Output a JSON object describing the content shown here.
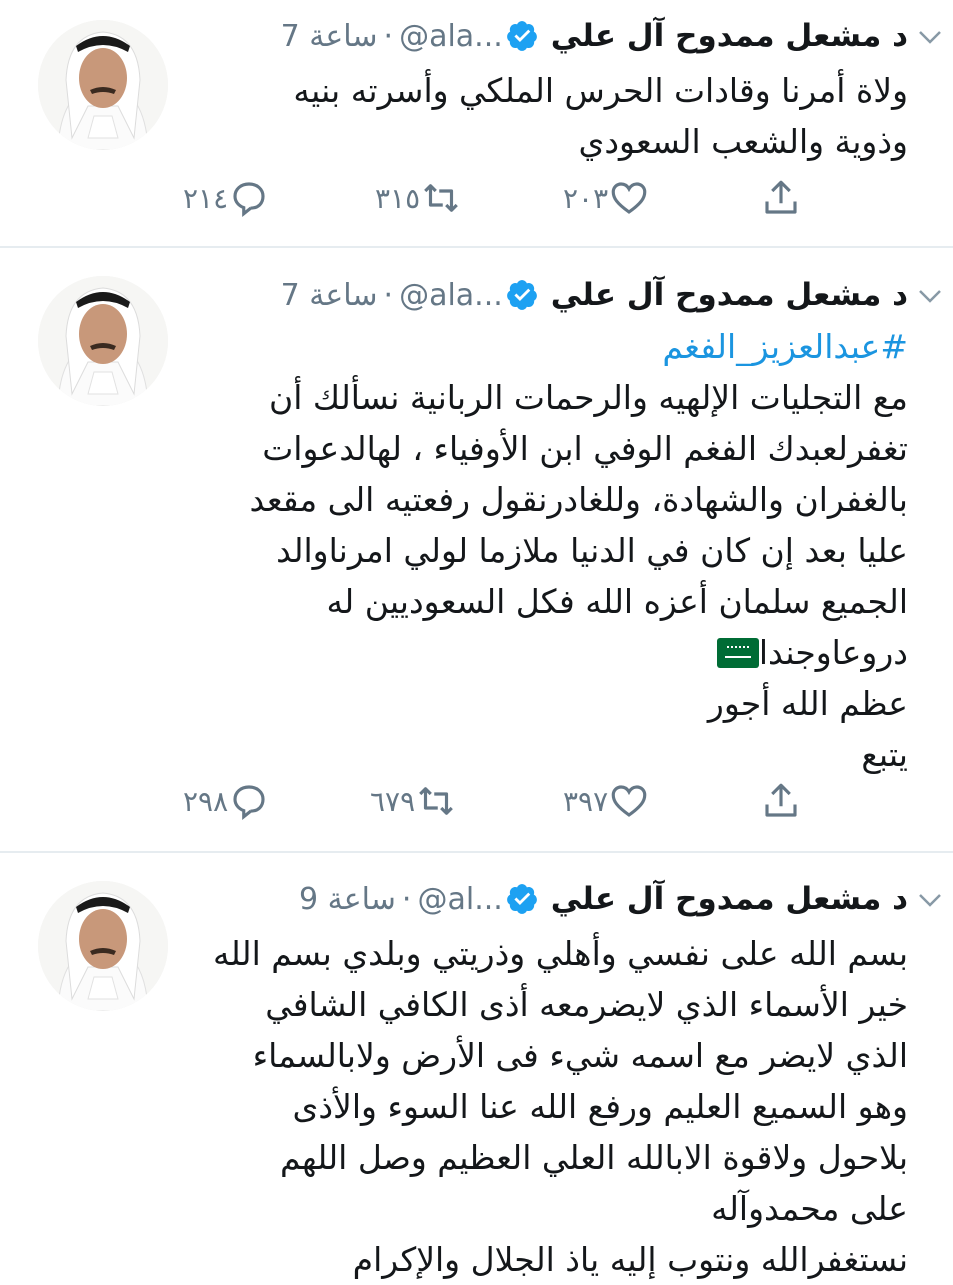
{
  "colors": {
    "accent": "#1da1f2",
    "hashtag": "#1b95e0",
    "muted": "#657786",
    "text": "#14171a",
    "divider": "#e6ecf0"
  },
  "tweets": [
    {
      "name": "د مشعل ممدوح آل علي",
      "handle": "@ala...",
      "time": "7 ساعة",
      "hashtag": "",
      "lines": [
        "ولاة أمرنا وقادات الحرس الملكي وأسرته بنيه",
        "وذوية والشعب السعودي"
      ],
      "replies": "٢١٤",
      "retweets": "٣١٥",
      "likes": "٢٠٣"
    },
    {
      "name": "د مشعل ممدوح آل علي",
      "handle": "@ala...",
      "time": "7 ساعة",
      "hashtag": "#عبدالعزيز_الفغم",
      "lines": [
        "مع التجليات الإلهيه والرحمات الربانية نسألك أن",
        "تغفرلعبدك الفغم الوفي ابن الأوفياء ، لهالدعوات",
        "بالغفران والشهادة، وللغادرنقول رفعتيه الى مقعد",
        "عليا بعد إن كان في الدنيا ملازما لولي امرناوالد",
        "الجميع سلمان أعزه الله فكل السعوديين له",
        "دروعاوجندا",
        "عظم الله أجور",
        "يتبع"
      ],
      "replies": "٢٩٨",
      "retweets": "٦٧٩",
      "likes": "٣٩٧"
    },
    {
      "name": "د مشعل ممدوح آل علي",
      "handle": "@al...",
      "time": "9 ساعة",
      "hashtag": "",
      "lines": [
        "بسم الله على نفسي وأهلي وذريتي وبلدي بسم الله",
        "خير الأسماء الذي لايضرمعه أذى الكافي  الشافي",
        "الذي لايضر مع اسمه شيء فى الأرض ولابالسماء",
        "وهو السميع العليم ورفع الله عنا السوء والأذى",
        "بلاحول ولاقوة الابالله العلي العظيم وصل اللهم",
        "على محمدوآله",
        "نستغفرالله ونتوب إليه ياذ الجلال والإكرام"
      ]
    }
  ]
}
